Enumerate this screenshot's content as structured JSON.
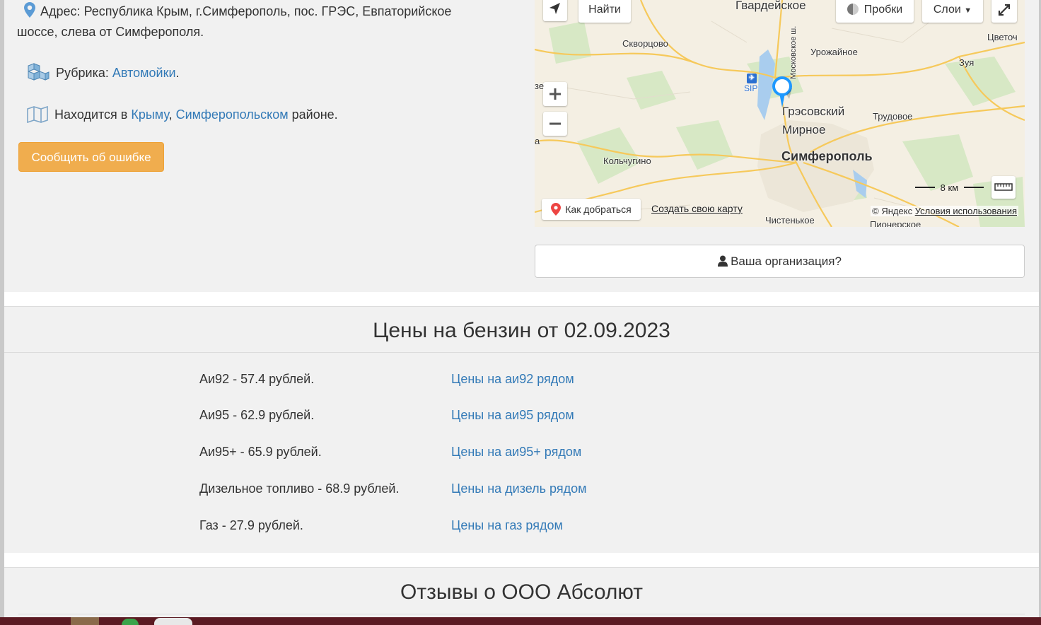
{
  "info": {
    "address_label": "Адрес:",
    "address_line1": "Республика Крым, г.Симферополь, пос. ГРЭС, Евпаторийское",
    "address_line2": "шоссе, слева от Симферополя.",
    "rubric_label": "Рубрика:",
    "rubric_link": "Автомойки",
    "rubric_end": ".",
    "location_prefix": "Находится в",
    "location_link1": "Крыму",
    "location_sep": ",",
    "location_link2": "Симферопольском",
    "location_suffix": "районе."
  },
  "report_button": "Сообщить об ошибке",
  "map": {
    "find_button": "Найти",
    "traffic_button": "Пробки",
    "layers_button": "Слои",
    "route_button": "Как добраться",
    "create_map_link": "Создать свою карту",
    "copyright_text": "© Яндекс",
    "terms_link": "Условия использования",
    "scale_label": "8 км",
    "places": {
      "gvardeyskoe": "Гвардейское",
      "skvortsovo": "Скворцово",
      "urozhaynoe": "Урожайное",
      "zuya": "Зуя",
      "tsvetoch": "Цветоч",
      "sip": "SIP",
      "moskovskoe": "Московское ш.",
      "gresovsky": "Грэсовский",
      "trudovoe": "Трудовое",
      "mirnoe": "Мирное",
      "kolchugino": "Кольчугино",
      "simferopol": "Симферополь",
      "chistenkoe": "Чистенькое",
      "pionerskoe": "Пионерское",
      "edge_ze": "зе",
      "edge_a": "а"
    }
  },
  "org_button": "Ваша организация?",
  "prices": {
    "title": "Цены на бензин от 02.09.2023",
    "rows": [
      {
        "label": "Аи92 - 57.4 рублей.",
        "link": "Цены на аи92 рядом"
      },
      {
        "label": "Аи95 - 62.9 рублей.",
        "link": "Цены на аи95 рядом"
      },
      {
        "label": "Аи95+ - 65.9 рублей.",
        "link": "Цены на аи95+ рядом"
      },
      {
        "label": "Дизельное топливо - 68.9 рублей.",
        "link": "Цены на дизель рядом"
      },
      {
        "label": "Газ - 27.9 рублей.",
        "link": "Цены на газ рядом"
      }
    ]
  },
  "reviews": {
    "title": "Отзывы о ООО Абсолют"
  },
  "colors": {
    "link": "#337ab7",
    "warning_button": "#f0ad4e",
    "map_pin": "#1e98ff",
    "route_pin": "#ed4543"
  }
}
